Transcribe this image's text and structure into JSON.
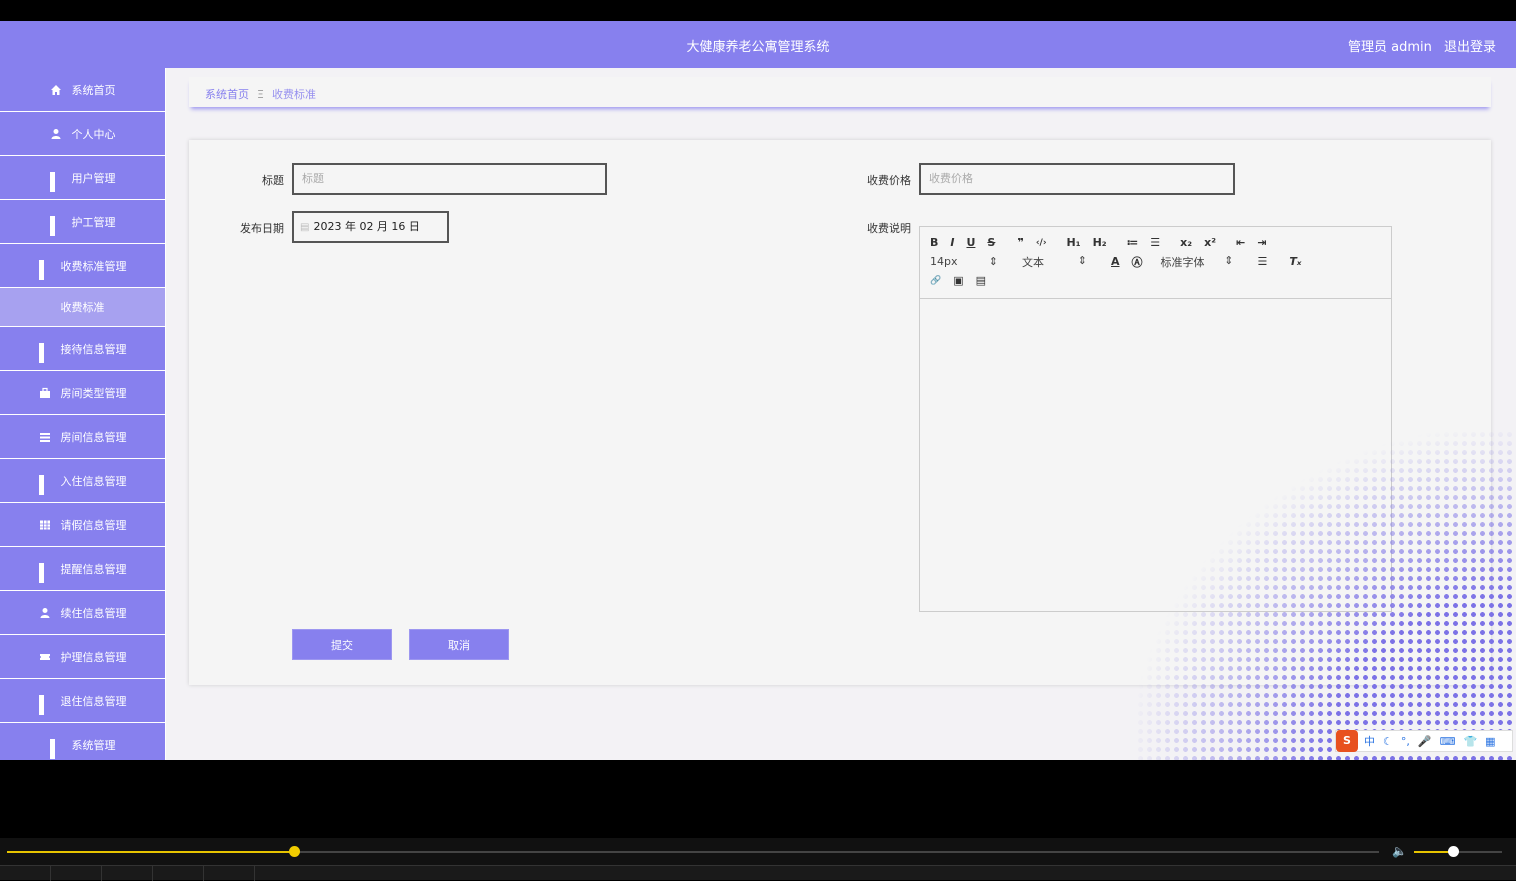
{
  "header": {
    "title": "大健康养老公寓管理系统",
    "user": "管理员 admin",
    "logout": "退出登录"
  },
  "sidebar": {
    "items": [
      {
        "label": "系统首页",
        "icon": "home-icon"
      },
      {
        "label": "个人中心",
        "icon": "user-icon"
      },
      {
        "label": "用户管理",
        "icon": "grid-icon"
      },
      {
        "label": "护工管理",
        "icon": "grid-icon"
      },
      {
        "label": "收费标准管理",
        "icon": "grid-icon"
      },
      {
        "label": "收费标准",
        "icon": "",
        "sub": true
      },
      {
        "label": "接待信息管理",
        "icon": "grid-icon"
      },
      {
        "label": "房间类型管理",
        "icon": "briefcase-icon"
      },
      {
        "label": "房间信息管理",
        "icon": "list-icon"
      },
      {
        "label": "入住信息管理",
        "icon": "grid-icon"
      },
      {
        "label": "请假信息管理",
        "icon": "table-icon"
      },
      {
        "label": "提醒信息管理",
        "icon": "grid-icon"
      },
      {
        "label": "续住信息管理",
        "icon": "user-icon"
      },
      {
        "label": "护理信息管理",
        "icon": "ticket-icon"
      },
      {
        "label": "退住信息管理",
        "icon": "grid-icon"
      },
      {
        "label": "系统管理",
        "icon": "grid-icon"
      }
    ]
  },
  "breadcrumb": {
    "home": "系统首页",
    "separator": "Ξ",
    "current": "收费标准"
  },
  "form": {
    "title_label": "标题",
    "title_placeholder": "标题",
    "date_label": "发布日期",
    "date_value": "2023 年 02 月 16 日",
    "price_label": "收费价格",
    "price_placeholder": "收费价格",
    "desc_label": "收费说明",
    "submit": "提交",
    "cancel": "取消"
  },
  "editor": {
    "row1": [
      "B",
      "I",
      "U",
      "S",
      "❞",
      "‹/›",
      "H₁",
      "H₂",
      "≔",
      "☰",
      "x₂",
      "x²",
      "⇤",
      "⇥"
    ],
    "font_size": "14px",
    "text_style": "文本",
    "font_family": "标准字体",
    "row3": [
      "🔗",
      "▣",
      "▤"
    ]
  },
  "ime": {
    "items": [
      "中",
      "☾",
      "°,",
      "🎤",
      "⌨",
      "👕",
      "▦"
    ]
  },
  "player": {
    "progress": 0.209,
    "volume": 0.44
  },
  "colors": {
    "primary": "#8780ee",
    "accent": "#e7c400"
  }
}
